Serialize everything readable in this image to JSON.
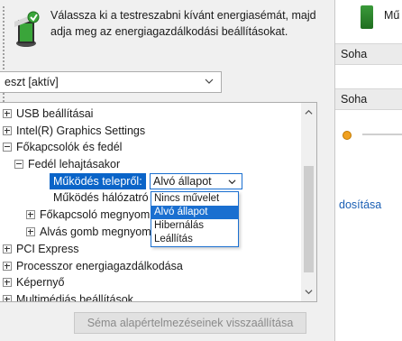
{
  "header": {
    "description": "Válassza ki a testreszabni kívánt energiasémát, majd adja meg az energiagazdálkodási beállításokat."
  },
  "plan_select": {
    "value": "eszt [aktív]"
  },
  "tree": {
    "items": [
      {
        "label": "USB beállításai",
        "expander": "plus"
      },
      {
        "label": "Intel(R) Graphics Settings",
        "expander": "plus"
      },
      {
        "label": "Főkapcsolók és fedél",
        "expander": "minus"
      },
      {
        "label": "Fedél lehajtásakor",
        "expander": "minus"
      },
      {
        "label": "Működés telepről:",
        "expander": "none"
      },
      {
        "label": "Működés hálózatró",
        "expander": "none"
      },
      {
        "label": "Főkapcsoló megnyom",
        "expander": "plus"
      },
      {
        "label": "Alvás gomb megnyom",
        "expander": "plus"
      },
      {
        "label": "PCI Express",
        "expander": "plus"
      },
      {
        "label": "Processzor energiagazdálkodása",
        "expander": "plus"
      },
      {
        "label": "Képernyő",
        "expander": "plus"
      },
      {
        "label": "Multimédiás beállítások",
        "expander": "plus"
      }
    ]
  },
  "value_select": {
    "value": "Alvó állapot"
  },
  "dropdown": {
    "options": [
      "Nincs művelet",
      "Alvó állapot",
      "Hibernálás",
      "Leállítás"
    ],
    "selected_index": 1
  },
  "restore_button": {
    "label": "Séma alapértelmezéseinek visszaállítása"
  },
  "background": {
    "title": "Mű",
    "row1_value": "Soha",
    "row2_value": "Soha",
    "link_text": "dosítása"
  },
  "colors": {
    "selection": "#0a64c8",
    "accent": "#1a6fd0"
  }
}
